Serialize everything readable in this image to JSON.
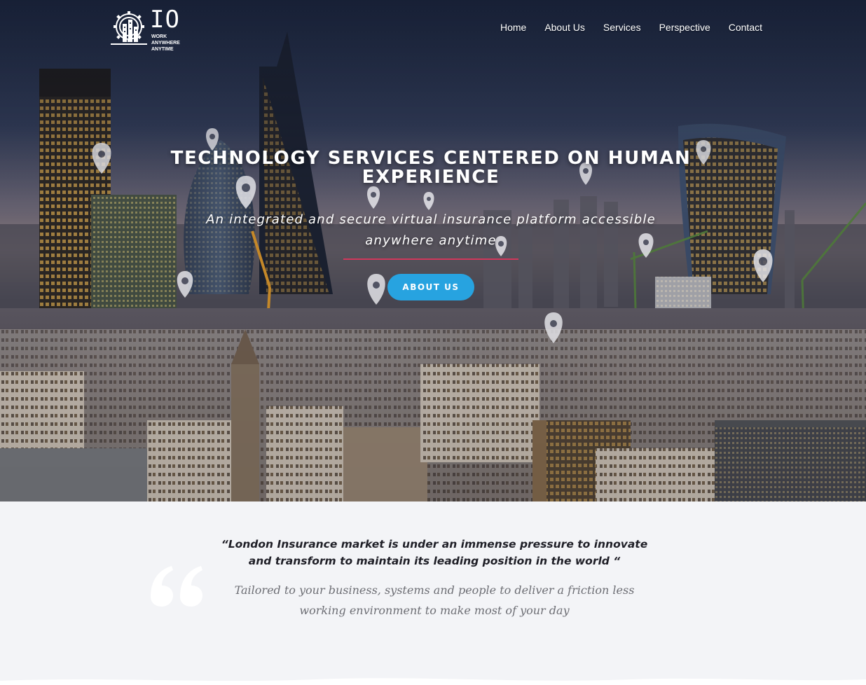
{
  "brand": {
    "logo_text": "IO",
    "tagline": "WORK ANYWHERE ANYTIME"
  },
  "nav": {
    "items": [
      {
        "label": "Home"
      },
      {
        "label": "About Us"
      },
      {
        "label": "Services"
      },
      {
        "label": "Perspective"
      },
      {
        "label": "Contact"
      }
    ]
  },
  "hero": {
    "title": "TECHNOLOGY SERVICES CENTERED ON HUMAN EXPERIENCE",
    "subtitle": "An integrated and secure virtual insurance platform accessible anywhere anytime",
    "cta_label": "ABOUT US",
    "accent_color": "#d2375b",
    "button_color": "#27a3e0"
  },
  "quote": {
    "headline": "“London Insurance market is under an immense pressure to innovate and  transform to maintain its leading position in the world “",
    "body": "Tailored to your business, systems and people to deliver a friction less working environment to make most of your day",
    "icon": "quote-marks-icon"
  }
}
